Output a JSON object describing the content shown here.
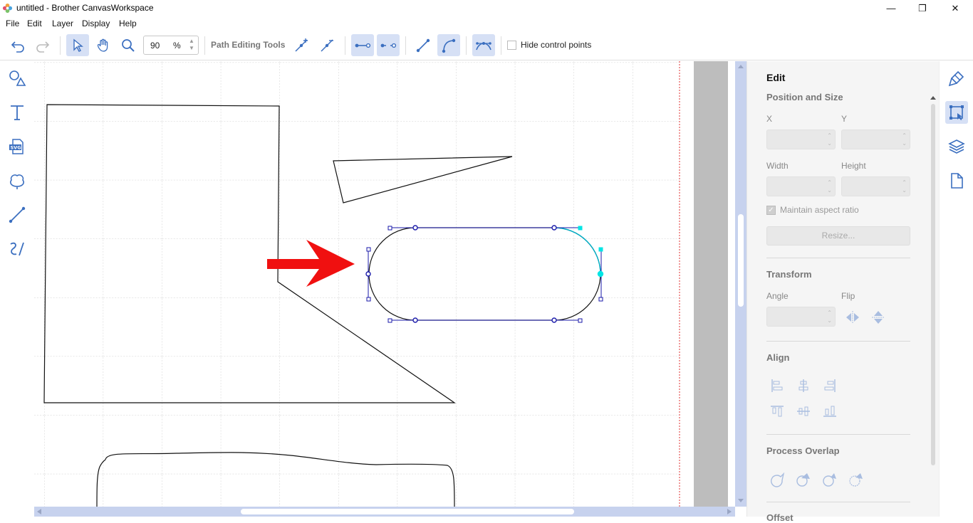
{
  "window": {
    "title": "untitled - Brother CanvasWorkspace",
    "minimize": "—",
    "restore": "❐",
    "close": "✕"
  },
  "menu": [
    "File",
    "Edit",
    "Layer",
    "Display",
    "Help"
  ],
  "toolbar": {
    "zoom_value": "90",
    "zoom_unit": "%",
    "path_editing_label": "Path Editing Tools",
    "hide_control_points": "Hide control points",
    "hide_control_points_checked": false,
    "icons": [
      "undo-icon",
      "redo-icon",
      "select-icon",
      "hand-icon",
      "zoom-icon",
      "add-node-icon",
      "delete-node-icon",
      "join-nodes-icon",
      "break-path-icon",
      "straight-line-icon",
      "curve-icon",
      "smooth-node-icon"
    ]
  },
  "left_tools": [
    "shapes-icon",
    "text-icon",
    "svg-import-icon",
    "pattern-icon",
    "line-icon",
    "freehand-icon"
  ],
  "right_panel": {
    "title": "Edit",
    "position_size": {
      "heading": "Position and Size",
      "x_label": "X",
      "y_label": "Y",
      "width_label": "Width",
      "height_label": "Height",
      "x_value": "",
      "y_value": "",
      "width_value": "",
      "height_value": "",
      "maintain_aspect": "Maintain aspect ratio",
      "maintain_aspect_checked": true,
      "resize_button": "Resize..."
    },
    "transform": {
      "heading": "Transform",
      "angle_label": "Angle",
      "flip_label": "Flip",
      "angle_value": ""
    },
    "align": {
      "heading": "Align"
    },
    "process_overlap": {
      "heading": "Process Overlap"
    },
    "offset": {
      "heading": "Offset"
    }
  },
  "far_right_tabs": [
    "paint-icon",
    "edit-transform-icon",
    "layers-icon",
    "page-icon"
  ],
  "colors": {
    "accent": "#d6e0f5",
    "scrollbar": "#c7d2ee",
    "selection": "#1a1aaa",
    "highlight_node": "#00e5e5",
    "arrow": "#f01010",
    "page_border": "#e03030"
  }
}
